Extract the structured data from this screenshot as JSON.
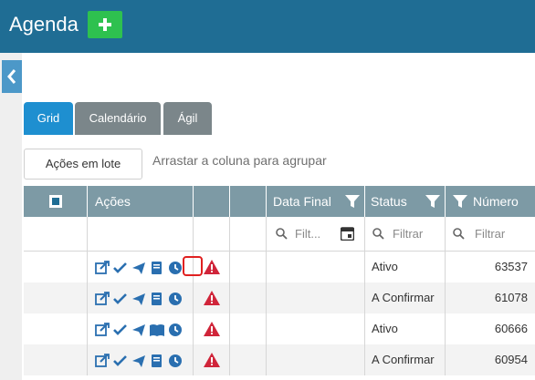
{
  "app": {
    "title": "Agenda",
    "add_icon": "plus-icon"
  },
  "tabs": [
    {
      "label": "Grid",
      "active": true
    },
    {
      "label": "Calendário",
      "active": false
    },
    {
      "label": "Ágil",
      "active": false
    }
  ],
  "toolbar": {
    "batch_label": "Ações em lote",
    "group_hint": "Arrastar a coluna para agrupar"
  },
  "columns": {
    "acoes": "Ações",
    "data_final": "Data Final",
    "status": "Status",
    "numero": "Número"
  },
  "filters": {
    "data_final_placeholder": "Filt...",
    "status_placeholder": "Filtrar",
    "numero_placeholder": "Filtrar"
  },
  "rows": [
    {
      "status": "Ativo",
      "numero": "63537",
      "book_icon": "notebook-icon"
    },
    {
      "status": "A Confirmar",
      "numero": "61078",
      "book_icon": "notebook-icon"
    },
    {
      "status": "Ativo",
      "numero": "60666",
      "book_icon": "open-book-icon"
    },
    {
      "status": "A Confirmar",
      "numero": "60954",
      "book_icon": "notebook-icon"
    }
  ],
  "colors": {
    "header": "#1f6d94",
    "accent": "#1e8fd0",
    "add": "#2ec14f",
    "warning": "#d0253a",
    "grid_header": "#7d9aa5",
    "icon": "#2a6fb0"
  }
}
